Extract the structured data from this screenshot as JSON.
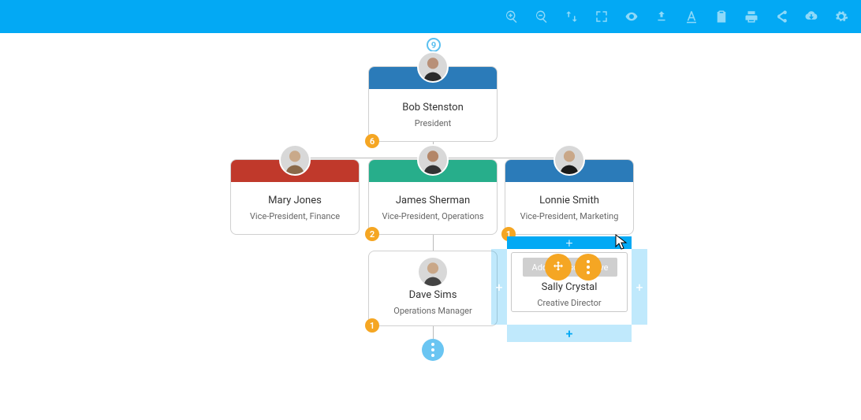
{
  "toolbar": {
    "icons": [
      "zoom-in",
      "zoom-out",
      "swap",
      "fullscreen",
      "visibility",
      "cloud-upload",
      "text-style",
      "clipboard",
      "print",
      "share",
      "cloud-download",
      "settings"
    ]
  },
  "top_badge": "9",
  "nodes": {
    "ceo": {
      "name": "Bob Stenston",
      "title": "President",
      "stripe": "#2b7bb9",
      "badge": "6"
    },
    "vp_finance": {
      "name": "Mary Jones",
      "title": "Vice-President, Finance",
      "stripe": "#c0392b"
    },
    "vp_ops": {
      "name": "James Sherman",
      "title": "Vice-President, Operations",
      "stripe": "#27ae8b",
      "badge": "2"
    },
    "vp_marketing": {
      "name": "Lonnie Smith",
      "title": "Vice-President, Marketing",
      "stripe": "#2b7bb9",
      "badge": "1"
    },
    "ops_mgr": {
      "name": "Dave Sims",
      "title": "Operations Manager",
      "badge": "1"
    },
    "creative": {
      "name": "Sally Crystal",
      "title": "Creative Director",
      "ghost_button": "Add a person above"
    }
  },
  "plus": "+",
  "colors": {
    "toolbar_bg": "#03a9f4",
    "badge_bg": "#f5a623",
    "selection": "#03a9f4"
  }
}
